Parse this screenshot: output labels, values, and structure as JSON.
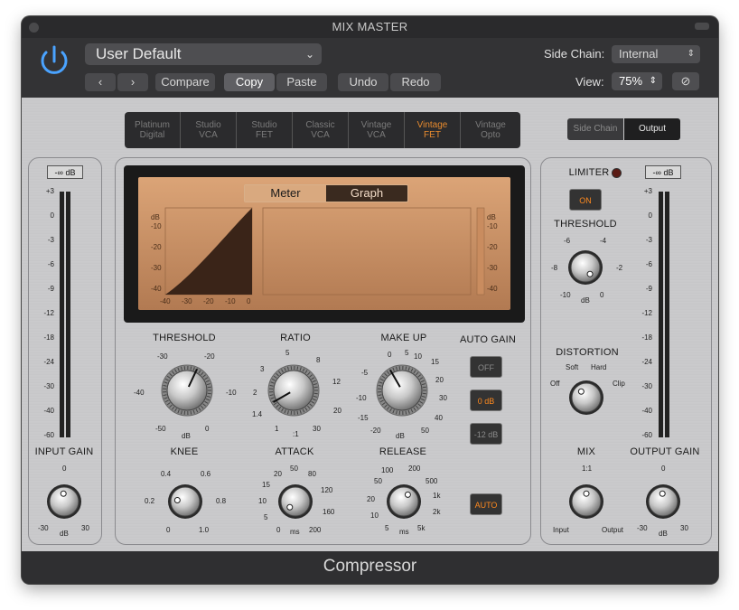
{
  "window": {
    "title": "MIX MASTER",
    "footer": "Compressor"
  },
  "header": {
    "preset": "User Default",
    "compare": "Compare",
    "copy": "Copy",
    "paste": "Paste",
    "undo": "Undo",
    "redo": "Redo",
    "side_chain_label": "Side Chain:",
    "side_chain_value": "Internal",
    "view_label": "View:",
    "view_value": "75%"
  },
  "models": [
    {
      "l1": "Platinum",
      "l2": "Digital"
    },
    {
      "l1": "Studio",
      "l2": "VCA"
    },
    {
      "l1": "Studio",
      "l2": "FET"
    },
    {
      "l1": "Classic",
      "l2": "VCA"
    },
    {
      "l1": "Vintage",
      "l2": "VCA"
    },
    {
      "l1": "Vintage",
      "l2": "FET"
    },
    {
      "l1": "Vintage",
      "l2": "Opto"
    }
  ],
  "selected_model": "Vintage FET",
  "sidechain_output": {
    "side_chain": "Side Chain",
    "output": "Output"
  },
  "display": {
    "meter": "Meter",
    "graph": "Graph"
  },
  "graph_ticks_left": [
    "dB",
    "-10",
    "-20",
    "-30",
    "-40"
  ],
  "graph_ticks_bottom": [
    "-40",
    "-30",
    "-20",
    "-10",
    "0"
  ],
  "graph_ticks_right": [
    "dB",
    "-10",
    "-20",
    "-30",
    "-40"
  ],
  "meter_scale": [
    "+3",
    "0",
    "-3",
    "-6",
    "-9",
    "-12",
    "-18",
    "-24",
    "-30",
    "-40",
    "-60"
  ],
  "input": {
    "readout": "-∞ dB",
    "label": "INPUT GAIN",
    "t0": "0",
    "tmin": "-30",
    "tunit": "dB",
    "tmax": "30"
  },
  "output": {
    "readout": "-∞ dB",
    "label": "OUTPUT GAIN",
    "t0": "0",
    "tmin": "-30",
    "tunit": "dB",
    "tmax": "30"
  },
  "knobs": {
    "threshold": {
      "label": "THRESHOLD",
      "t": [
        "-30",
        "-20",
        "-40",
        "-10",
        "-50",
        "dB",
        "0"
      ]
    },
    "ratio": {
      "label": "RATIO",
      "t": [
        "5",
        "8",
        "3",
        "12",
        "2",
        "20",
        "1.4",
        "1",
        ":1",
        "30"
      ]
    },
    "makeup": {
      "label": "MAKE UP",
      "t": [
        "0",
        "5",
        "10",
        "15",
        "-5",
        "20",
        "-10",
        "30",
        "-15",
        "40",
        "-20",
        "dB",
        "50"
      ]
    },
    "knee": {
      "label": "KNEE",
      "t": [
        "0.4",
        "0.6",
        "0.2",
        "0.8",
        "0",
        "1.0"
      ]
    },
    "attack": {
      "label": "ATTACK",
      "t": [
        "20",
        "50",
        "80",
        "15",
        "120",
        "10",
        "160",
        "5",
        "0",
        "ms",
        "200"
      ]
    },
    "release": {
      "label": "RELEASE",
      "t": [
        "100",
        "200",
        "50",
        "500",
        "20",
        "1k",
        "10",
        "2k",
        "5",
        "ms",
        "5k"
      ]
    }
  },
  "autogain": {
    "label": "AUTO GAIN",
    "off": "OFF",
    "zero": "0 dB",
    "minus12": "-12 dB",
    "auto": "AUTO"
  },
  "limiter": {
    "label": "LIMITER",
    "on": "ON",
    "threshold_label": "THRESHOLD",
    "t": [
      "-6",
      "-4",
      "-8",
      "-2",
      "-10",
      "dB",
      "0"
    ]
  },
  "distortion": {
    "label": "DISTORTION",
    "t": [
      "Soft",
      "Hard",
      "Off",
      "Clip"
    ]
  },
  "mix": {
    "label": "MIX",
    "t": [
      "1:1",
      "Input",
      "Output"
    ]
  }
}
